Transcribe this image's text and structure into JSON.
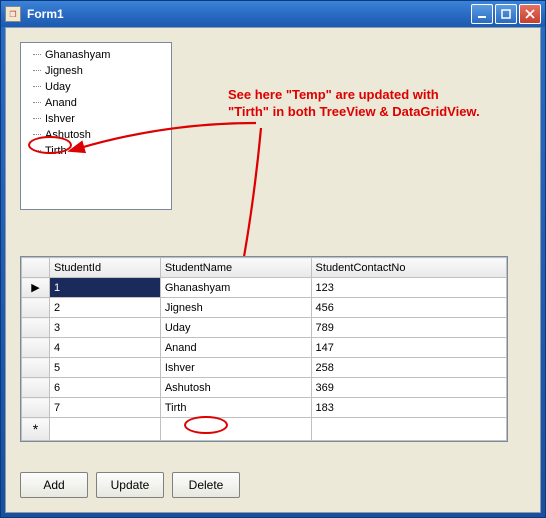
{
  "window": {
    "title": "Form1"
  },
  "treeview": {
    "items": [
      "Ghanashyam",
      "Jignesh",
      "Uday",
      "Anand",
      "Ishver",
      "Ashutosh",
      "Tirth"
    ]
  },
  "annotation": {
    "line1": "See here \"Temp\" are updated with",
    "line2": "\"Tirth\" in both TreeView & DataGridView."
  },
  "grid": {
    "columns": [
      "StudentId",
      "StudentName",
      "StudentContactNo"
    ],
    "rows": [
      {
        "id": "1",
        "name": "Ghanashyam",
        "contact": "123"
      },
      {
        "id": "2",
        "name": "Jignesh",
        "contact": "456"
      },
      {
        "id": "3",
        "name": "Uday",
        "contact": "789"
      },
      {
        "id": "4",
        "name": "Anand",
        "contact": "147"
      },
      {
        "id": "5",
        "name": "Ishver",
        "contact": "258"
      },
      {
        "id": "6",
        "name": "Ashutosh",
        "contact": "369"
      },
      {
        "id": "7",
        "name": "Tirth",
        "contact": "183"
      }
    ],
    "row_indicator": "▶",
    "new_row_indicator": "*"
  },
  "buttons": {
    "add": "Add",
    "update": "Update",
    "delete": "Delete"
  }
}
